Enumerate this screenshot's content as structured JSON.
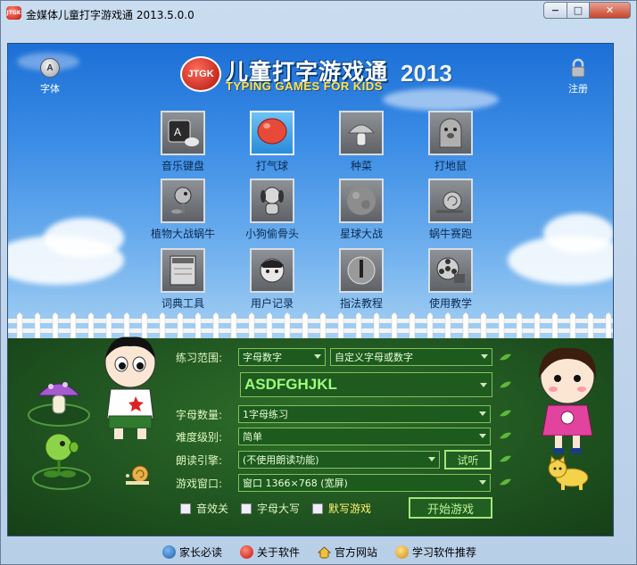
{
  "window": {
    "title": "金媒体儿童打字游戏通 2013.5.0.0",
    "app_icon_text": "JTGK",
    "min_glyph": "−",
    "max_glyph": "□",
    "close_glyph": "✕"
  },
  "header": {
    "badge": "JTGK",
    "title": "儿童打字游戏通",
    "year": "2013",
    "subtitle": "TYPING GAMES FOR KIDS",
    "font_button": "字体",
    "register_button": "注册"
  },
  "games": [
    {
      "label": "音乐键盘",
      "icon": "keyboard-icon"
    },
    {
      "label": "打气球",
      "icon": "balloon-icon"
    },
    {
      "label": "种菜",
      "icon": "mushroom-icon"
    },
    {
      "label": "打地鼠",
      "icon": "mole-icon"
    },
    {
      "label": "植物大战蜗牛",
      "icon": "plant-icon"
    },
    {
      "label": "小狗偷骨头",
      "icon": "dog-icon"
    },
    {
      "label": "星球大战",
      "icon": "planet-icon"
    },
    {
      "label": "蜗牛赛跑",
      "icon": "snail-icon"
    },
    {
      "label": "词典工具",
      "icon": "dictionary-icon"
    },
    {
      "label": "用户记录",
      "icon": "user-record-icon"
    },
    {
      "label": "指法教程",
      "icon": "fingering-icon"
    },
    {
      "label": "使用教学",
      "icon": "film-reel-icon"
    }
  ],
  "form": {
    "practice_range_label": "练习范围:",
    "practice_range_value": "字母数字",
    "custom_value": "自定义字母或数字",
    "practice_text": "ASDFGHJKL",
    "letter_count_label": "字母数量:",
    "letter_count_value": "1字母练习",
    "difficulty_label": "难度级别:",
    "difficulty_value": "简单",
    "voice_label": "朗读引擎:",
    "voice_value": "(不使用朗读功能)",
    "listen_button": "试听",
    "window_label": "游戏窗口:",
    "window_value": "窗口 1366×768 (宽屏)",
    "sound_off": "音效关",
    "uppercase": "字母大写",
    "dictation": "默写游戏",
    "start_button": "开始游戏"
  },
  "statusbar": {
    "parents": "家长必读",
    "about": "关于软件",
    "website": "官方网站",
    "recommend": "学习软件推荐"
  },
  "colors": {
    "sky_top": "#1c6fd6",
    "grass": "#1f5320",
    "accent_green": "#7fc35a",
    "title_yellow": "#ffe34a"
  }
}
